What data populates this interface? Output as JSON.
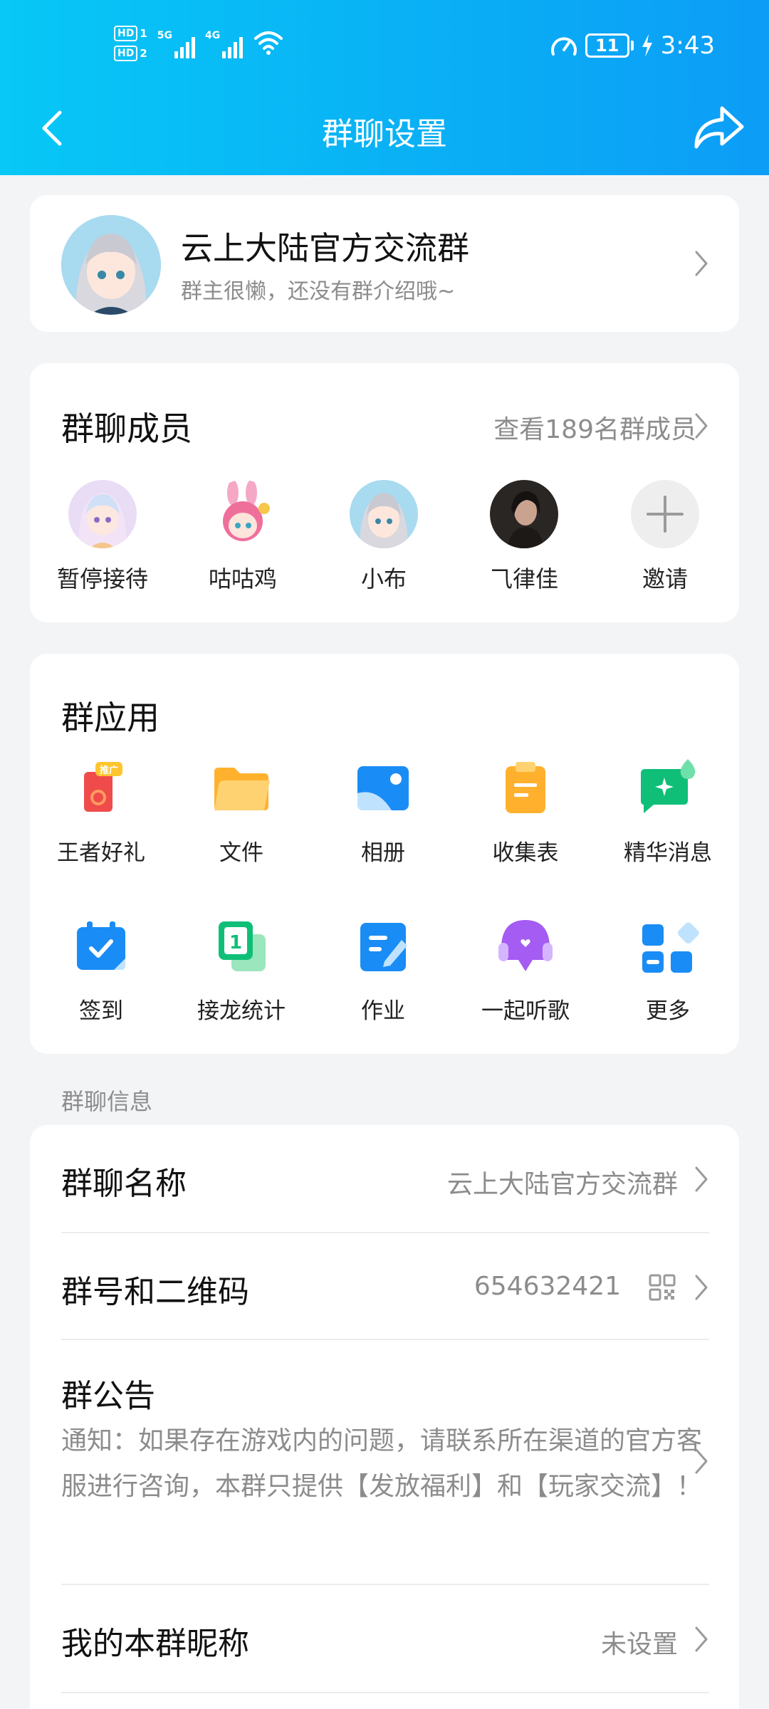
{
  "status_bar": {
    "sim1": "HD",
    "sim1_num": "1",
    "sim2": "HD",
    "sim2_num": "2",
    "net1": "5G",
    "net2": "4G",
    "battery": "11",
    "time": "3:43"
  },
  "nav": {
    "title": "群聊设置"
  },
  "group": {
    "name": "云上大陆官方交流群",
    "description": "群主很懒，还没有群介绍哦~"
  },
  "members": {
    "title": "群聊成员",
    "view_all": "查看189名群成员",
    "list": [
      {
        "name": "暂停接待"
      },
      {
        "name": "咕咕鸡"
      },
      {
        "name": "小布"
      },
      {
        "name": "⺄律佳"
      },
      {
        "name": "邀请"
      }
    ]
  },
  "apps": {
    "title": "群应用",
    "badge": "推广",
    "items": [
      {
        "label": "王者好礼",
        "icon": "gift-icon"
      },
      {
        "label": "文件",
        "icon": "folder-icon"
      },
      {
        "label": "相册",
        "icon": "album-icon"
      },
      {
        "label": "收集表",
        "icon": "form-icon"
      },
      {
        "label": "精华消息",
        "icon": "essence-message-icon"
      },
      {
        "label": "签到",
        "icon": "checkin-calendar-icon"
      },
      {
        "label": "接龙统计",
        "icon": "relay-stats-icon"
      },
      {
        "label": "作业",
        "icon": "homework-icon"
      },
      {
        "label": "一起听歌",
        "icon": "music-together-icon"
      },
      {
        "label": "更多",
        "icon": "more-apps-icon"
      }
    ]
  },
  "info": {
    "section_label": "群聊信息",
    "group_name_label": "群聊名称",
    "group_name_value": "云上大陆官方交流群",
    "group_number_label": "群号和二维码",
    "group_number_value": "654632421",
    "announcement_label": "群公告",
    "announcement_text": "通知：如果存在游戏内的问题，请联系所在渠道的官方客服进行咨询，本群只提供【发放福利】和【玩家交流】！",
    "nickname_label": "我的本群昵称",
    "nickname_value": "未设置"
  },
  "colors": {
    "header_start": "#07c8f6",
    "header_end": "#0c9df6",
    "accent_blue": "#1a8cf5"
  }
}
